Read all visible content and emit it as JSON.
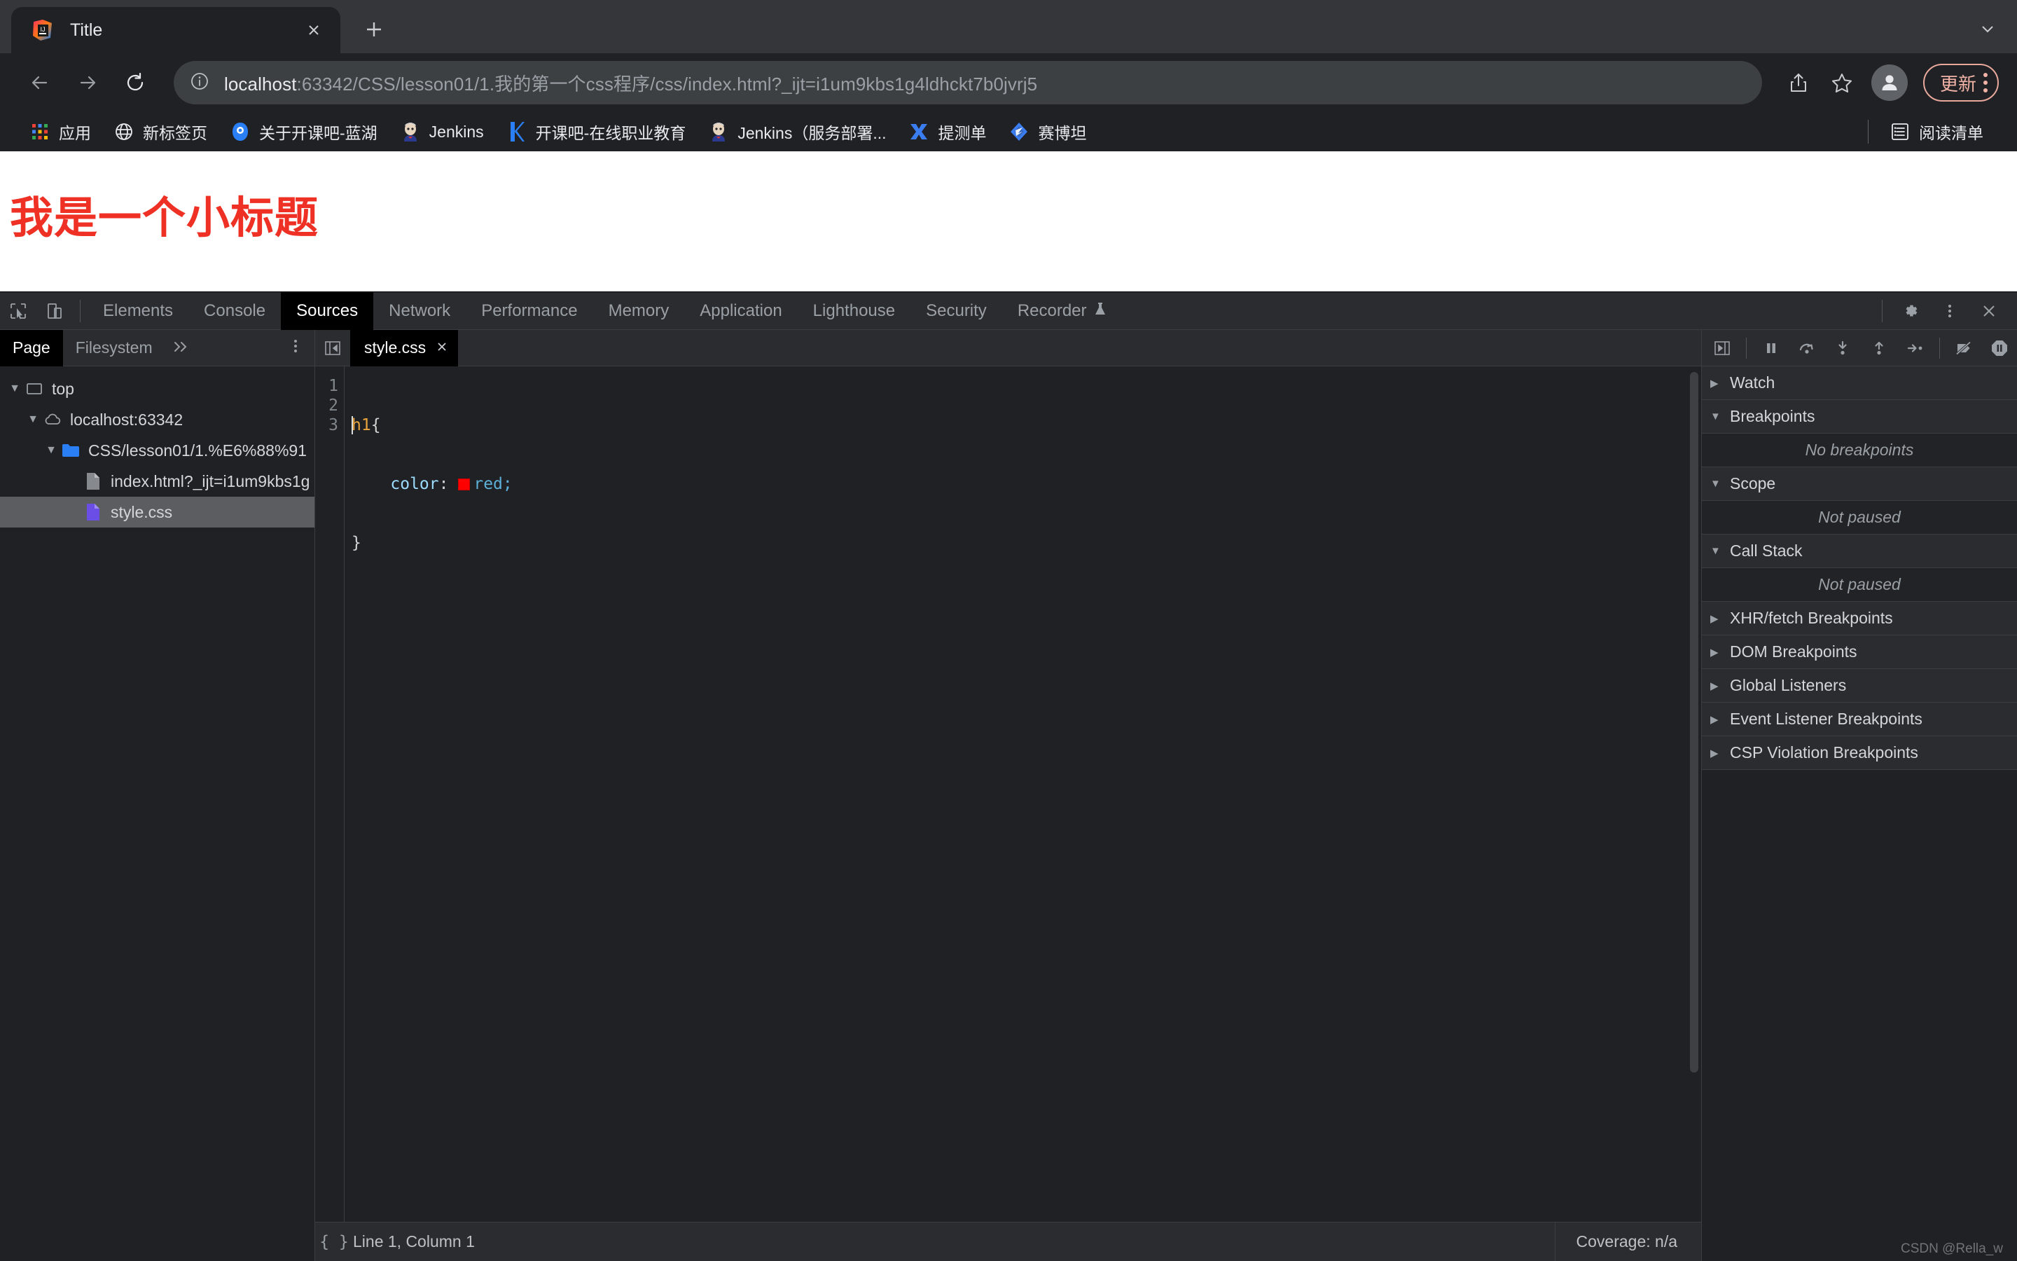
{
  "browser": {
    "tab": {
      "title": "Title",
      "favicon": "intellij-idea-icon",
      "close_icon": "close-icon"
    },
    "new_tab_icon": "plus-icon",
    "tabstrip_menu_icon": "chevron-down-icon",
    "toolbar": {
      "back_icon": "back-arrow-icon",
      "forward_icon": "forward-arrow-icon",
      "reload_icon": "reload-icon",
      "site_info_icon": "info-circle-icon",
      "url_host": "localhost",
      "url_rest": ":63342/CSS/lesson01/1.我的第一个css程序/css/index.html?_ijt=i1um9kbs1g4ldhckt7b0jvrj5",
      "share_icon": "share-icon",
      "bookmark_icon": "star-icon",
      "profile_icon": "avatar-icon",
      "update_label": "更新",
      "menu_icon": "kebab-menu-icon"
    },
    "bookmarks": [
      {
        "label": "应用",
        "icon": "apps-grid-icon"
      },
      {
        "label": "新标签页",
        "icon": "globe-icon"
      },
      {
        "label": "关于开课吧-蓝湖",
        "icon": "lanhu-icon"
      },
      {
        "label": "Jenkins",
        "icon": "jenkins-icon"
      },
      {
        "label": "开课吧-在线职业教育",
        "icon": "kaikeba-icon"
      },
      {
        "label": "Jenkins（服务部署...",
        "icon": "jenkins-icon"
      },
      {
        "label": "提测单",
        "icon": "ticeidan-icon"
      },
      {
        "label": "赛博坦",
        "icon": "cybertron-icon"
      }
    ],
    "reading_list": {
      "label": "阅读清单",
      "icon": "reading-list-icon"
    }
  },
  "page": {
    "heading": "我是一个小标题",
    "heading_color": "#ee3124"
  },
  "devtools": {
    "inspect_icon": "inspect-cursor-icon",
    "device_toolbar_icon": "device-toolbar-icon",
    "tabs": [
      {
        "label": "Elements",
        "active": false
      },
      {
        "label": "Console",
        "active": false
      },
      {
        "label": "Sources",
        "active": true
      },
      {
        "label": "Network",
        "active": false
      },
      {
        "label": "Performance",
        "active": false
      },
      {
        "label": "Memory",
        "active": false
      },
      {
        "label": "Application",
        "active": false
      },
      {
        "label": "Lighthouse",
        "active": false
      },
      {
        "label": "Security",
        "active": false
      },
      {
        "label": "Recorder",
        "active": false,
        "badge": "experiment-flask-icon"
      }
    ],
    "settings_icon": "gear-icon",
    "more_icon": "kebab-menu-icon",
    "close_icon": "close-icon",
    "navigator": {
      "tabs": [
        {
          "label": "Page",
          "active": true
        },
        {
          "label": "Filesystem",
          "active": false
        }
      ],
      "overflow_icon": "double-chevron-right-icon",
      "more_icon": "kebab-menu-icon",
      "tree": [
        {
          "label": "top",
          "icon": "frame-icon",
          "twisty": "▼",
          "depth": 0,
          "selected": false
        },
        {
          "label": "localhost:63342",
          "icon": "cloud-icon",
          "twisty": "▼",
          "depth": 1,
          "selected": false
        },
        {
          "label": "CSS/lesson01/1.%E6%88%91",
          "icon": "folder-icon",
          "twisty": "▼",
          "depth": 2,
          "selected": false
        },
        {
          "label": "index.html?_ijt=i1um9kbs1g",
          "icon": "html-file-icon",
          "twisty": "",
          "depth": 3,
          "selected": false
        },
        {
          "label": "style.css",
          "icon": "css-file-icon",
          "twisty": "",
          "depth": 3,
          "selected": true
        }
      ]
    },
    "editor": {
      "collapse_icon": "collapse-sidebar-icon",
      "tab_label": "style.css",
      "tab_close_icon": "close-icon",
      "lines": [
        "1",
        "2",
        "3"
      ],
      "code": {
        "line1_selector": "h1",
        "line1_brace": "{",
        "line2_property": "color",
        "line2_colon": ":",
        "line2_value": "red",
        "line2_semicolon": ";",
        "line2_swatch_color": "#ff0000",
        "line3_brace": "}"
      }
    },
    "statusbar": {
      "format_icon": "curly-braces-icon",
      "cursor_position": "Line 1, Column 1",
      "coverage": "Coverage: n/a"
    },
    "debugger": {
      "collapse_icon": "expand-sidebar-icon",
      "buttons": [
        {
          "name": "resume-pause-icon",
          "title": "pause"
        },
        {
          "name": "step-over-icon",
          "title": "step over"
        },
        {
          "name": "step-into-icon",
          "title": "step into"
        },
        {
          "name": "step-out-icon",
          "title": "step out"
        },
        {
          "name": "step-icon",
          "title": "step"
        },
        {
          "name": "deactivate-breakpoints-icon",
          "title": "deactivate breakpoints"
        },
        {
          "name": "pause-on-exceptions-icon",
          "title": "pause on exceptions"
        }
      ],
      "sections": [
        {
          "label": "Watch",
          "twisty": "▶",
          "empty": null
        },
        {
          "label": "Breakpoints",
          "twisty": "▼",
          "empty": "No breakpoints"
        },
        {
          "label": "Scope",
          "twisty": "▼",
          "empty": "Not paused"
        },
        {
          "label": "Call Stack",
          "twisty": "▼",
          "empty": "Not paused"
        },
        {
          "label": "XHR/fetch Breakpoints",
          "twisty": "▶",
          "empty": null
        },
        {
          "label": "DOM Breakpoints",
          "twisty": "▶",
          "empty": null
        },
        {
          "label": "Global Listeners",
          "twisty": "▶",
          "empty": null
        },
        {
          "label": "Event Listener Breakpoints",
          "twisty": "▶",
          "empty": null
        },
        {
          "label": "CSP Violation Breakpoints",
          "twisty": "▶",
          "empty": null
        }
      ]
    }
  },
  "watermark": "CSDN @Rella_w"
}
